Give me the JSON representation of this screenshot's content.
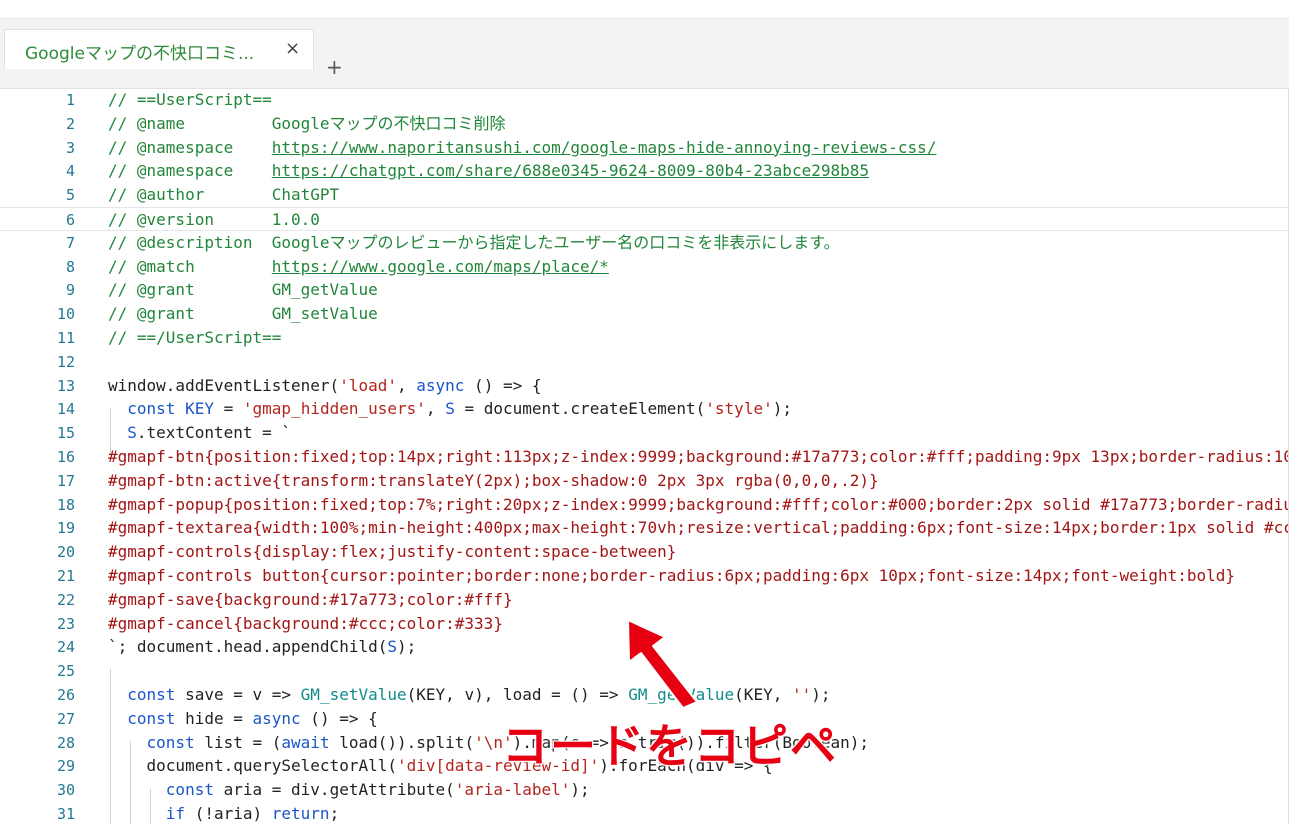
{
  "tab": {
    "title": "Googleマップの不快口コミ...",
    "close": "×",
    "add": "+"
  },
  "active_line": 6,
  "colors": {
    "annotation": "#e60012",
    "tab_title": "#2f8a3a"
  },
  "lines": [
    {
      "n": "1",
      "segs": [
        [
          "c",
          "// ==UserScript=="
        ]
      ]
    },
    {
      "n": "2",
      "segs": [
        [
          "c",
          "// @name         Googleマップの不快口コミ削除"
        ]
      ]
    },
    {
      "n": "3",
      "segs": [
        [
          "c",
          "// @namespace    "
        ],
        [
          "u",
          "https://www.naporitansushi.com/google-maps-hide-annoying-reviews-css/"
        ]
      ]
    },
    {
      "n": "4",
      "segs": [
        [
          "c",
          "// @namespace    "
        ],
        [
          "u",
          "https://chatgpt.com/share/688e0345-9624-8009-80b4-23abce298b85"
        ]
      ]
    },
    {
      "n": "5",
      "segs": [
        [
          "c",
          "// @author       ChatGPT"
        ]
      ]
    },
    {
      "n": "6",
      "segs": [
        [
          "c",
          "// @version      1.0.0"
        ]
      ]
    },
    {
      "n": "7",
      "segs": [
        [
          "c",
          "// @description  Googleマップのレビューから指定したユーザー名の口コミを非表示にします。"
        ]
      ]
    },
    {
      "n": "8",
      "segs": [
        [
          "c",
          "// @match        "
        ],
        [
          "u",
          "https://www.google.com/maps/place/*"
        ]
      ]
    },
    {
      "n": "9",
      "segs": [
        [
          "c",
          "// @grant        GM_getValue"
        ]
      ]
    },
    {
      "n": "10",
      "segs": [
        [
          "c",
          "// @grant        GM_setValue"
        ]
      ]
    },
    {
      "n": "11",
      "segs": [
        [
          "c",
          "// ==/UserScript=="
        ]
      ]
    },
    {
      "n": "12",
      "segs": []
    },
    {
      "n": "13",
      "segs": [
        [
          "d",
          "window.addEventListener("
        ],
        [
          "s",
          "'load'"
        ],
        [
          "d",
          ", "
        ],
        [
          "k",
          "async"
        ],
        [
          "d",
          " () => {"
        ]
      ]
    },
    {
      "n": "14",
      "segs": [
        [
          "d",
          "  "
        ],
        [
          "k",
          "const"
        ],
        [
          "d",
          " "
        ],
        [
          "k",
          "KEY"
        ],
        [
          "d",
          " = "
        ],
        [
          "s",
          "'gmap_hidden_users'"
        ],
        [
          "d",
          ", "
        ],
        [
          "k",
          "S"
        ],
        [
          "d",
          " = document.createElement("
        ],
        [
          "s",
          "'style'"
        ],
        [
          "d",
          ");"
        ]
      ]
    },
    {
      "n": "15",
      "segs": [
        [
          "d",
          "  "
        ],
        [
          "k",
          "S"
        ],
        [
          "d",
          ".textContent = `"
        ]
      ]
    },
    {
      "n": "16",
      "segs": [
        [
          "css",
          "#gmapf-btn{position:fixed;top:14px;right:113px;z-index:9999;background:#17a773;color:#fff;padding:9px 13px;border-radius:10"
        ]
      ]
    },
    {
      "n": "17",
      "segs": [
        [
          "css",
          "#gmapf-btn:active{transform:translateY(2px);box-shadow:0 2px 3px rgba(0,0,0,.2)}"
        ]
      ]
    },
    {
      "n": "18",
      "segs": [
        [
          "css",
          "#gmapf-popup{position:fixed;top:7%;right:20px;z-index:9999;background:#fff;color:#000;border:2px solid #17a773;border-radiu"
        ]
      ]
    },
    {
      "n": "19",
      "segs": [
        [
          "css",
          "#gmapf-textarea{width:100%;min-height:400px;max-height:70vh;resize:vertical;padding:6px;font-size:14px;border:1px solid #cc"
        ]
      ]
    },
    {
      "n": "20",
      "segs": [
        [
          "css",
          "#gmapf-controls{display:flex;justify-content:space-between}"
        ]
      ]
    },
    {
      "n": "21",
      "segs": [
        [
          "css",
          "#gmapf-controls button{cursor:pointer;border:none;border-radius:6px;padding:6px 10px;font-size:14px;font-weight:bold}"
        ]
      ]
    },
    {
      "n": "22",
      "segs": [
        [
          "css",
          "#gmapf-save{background:#17a773;color:#fff}"
        ]
      ]
    },
    {
      "n": "23",
      "segs": [
        [
          "css",
          "#gmapf-cancel{background:#ccc;color:#333}"
        ]
      ]
    },
    {
      "n": "24",
      "segs": [
        [
          "d",
          "`; document.head.appendChild("
        ],
        [
          "k",
          "S"
        ],
        [
          "d",
          ");"
        ]
      ]
    },
    {
      "n": "25",
      "segs": []
    },
    {
      "n": "26",
      "segs": [
        [
          "d",
          "  "
        ],
        [
          "k",
          "const"
        ],
        [
          "d",
          " save = v => "
        ],
        [
          "f",
          "GM_setValue"
        ],
        [
          "d",
          "(KEY, v), load = () => "
        ],
        [
          "f",
          "GM_getValue"
        ],
        [
          "d",
          "(KEY, "
        ],
        [
          "s",
          "''"
        ],
        [
          "d",
          ");"
        ]
      ]
    },
    {
      "n": "27",
      "segs": [
        [
          "d",
          "  "
        ],
        [
          "k",
          "const"
        ],
        [
          "d",
          " hide = "
        ],
        [
          "k",
          "async"
        ],
        [
          "d",
          " () => {"
        ]
      ]
    },
    {
      "n": "28",
      "segs": [
        [
          "d",
          "    "
        ],
        [
          "k",
          "const"
        ],
        [
          "d",
          " list = ("
        ],
        [
          "k",
          "await"
        ],
        [
          "d",
          " load()).split("
        ],
        [
          "s",
          "'\\n'"
        ],
        [
          "d",
          ").map(s => s.trim()).filter(Boolean);"
        ]
      ]
    },
    {
      "n": "29",
      "segs": [
        [
          "d",
          "    document.querySelectorAll("
        ],
        [
          "s",
          "'div[data-review-id]'"
        ],
        [
          "d",
          ").forEach(div => {"
        ]
      ]
    },
    {
      "n": "30",
      "segs": [
        [
          "d",
          "      "
        ],
        [
          "k",
          "const"
        ],
        [
          "d",
          " aria = div.getAttribute("
        ],
        [
          "s",
          "'aria-label'"
        ],
        [
          "d",
          ");"
        ]
      ]
    },
    {
      "n": "31",
      "segs": [
        [
          "d",
          "      "
        ],
        [
          "k",
          "if"
        ],
        [
          "d",
          " (!aria) "
        ],
        [
          "k",
          "return"
        ],
        [
          "d",
          ";"
        ]
      ]
    }
  ],
  "annotation": {
    "text": "コードをコピペ"
  }
}
